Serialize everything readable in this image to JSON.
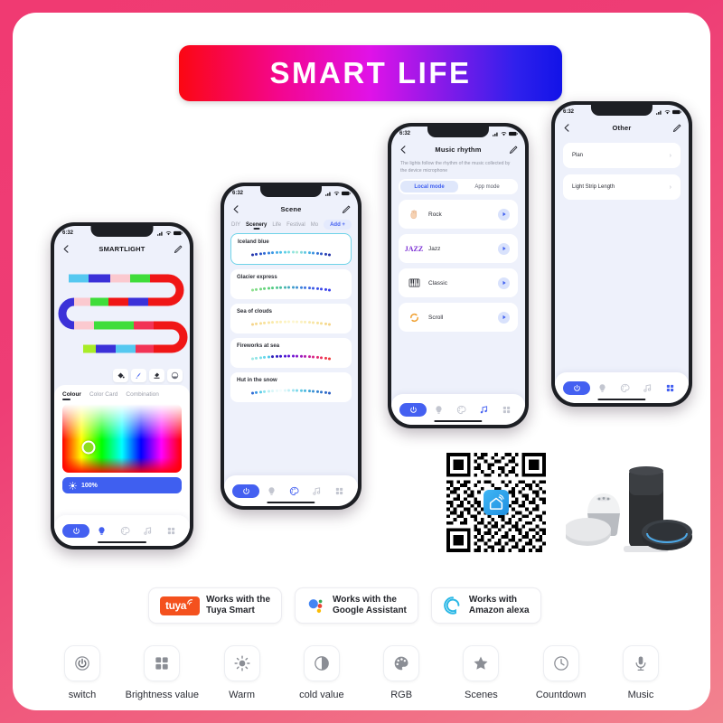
{
  "banner": {
    "title": "SMART LIFE"
  },
  "colors": {
    "frame_pink": "#f03a72",
    "accent_blue": "#4460f1",
    "tuya_orange": "#f4511e",
    "alexa_cyan": "#2bb8e6",
    "banner_from": "#fb0712",
    "banner_mid": "#e012e8",
    "banner_to": "#1213e8"
  },
  "phone1": {
    "status": {
      "time": "6:32",
      "location_icon": "location-arrow-icon",
      "signal_icon": "signal-icon",
      "wifi_icon": "wifi-icon",
      "battery_icon": "battery-icon"
    },
    "nav": {
      "back_icon": "chevron-left-icon",
      "title": "SMARTLIGHT",
      "edit_icon": "pencil-edit-icon"
    },
    "tools": [
      "paint-bucket-icon",
      "brush-icon",
      "eraser-icon",
      "segment-picker-icon"
    ],
    "tabs": [
      {
        "label": "Colour",
        "active": true
      },
      {
        "label": "Color Card",
        "active": false
      },
      {
        "label": "Combination",
        "active": false
      }
    ],
    "brightness": {
      "icon": "brightness-icon",
      "value": "100%"
    },
    "strip_rows": [
      [
        "#55c8f0",
        "#3b31d8",
        "#fbc9cf",
        "#3fdd3a",
        "#f01616"
      ],
      [
        "#fbc9cf",
        "#3fdd3a",
        "#f01616",
        "#3b31d8",
        "#f01616"
      ],
      [
        "#fbc9cf",
        "#3fdd3a",
        "#3fdd3a",
        "#f23355",
        "#f01616"
      ],
      [
        "#a8ec27",
        "#3b31d8",
        "#55c8f0",
        "#f23355",
        "#f01616"
      ]
    ],
    "tabbar": [
      "power-icon",
      "bulb-icon",
      "palette-icon",
      "music-note-icon",
      "grid-icon"
    ],
    "tabbar_active": 1
  },
  "phone2": {
    "status": {
      "time": "6:32"
    },
    "nav": {
      "title": "Scene"
    },
    "tabs": [
      {
        "label": "DIY",
        "active": false
      },
      {
        "label": "Scenery",
        "active": true
      },
      {
        "label": "Life",
        "active": false
      },
      {
        "label": "Festival",
        "active": false
      },
      {
        "label": "Mo",
        "active": false
      }
    ],
    "add_label": "Add +",
    "scenes": [
      {
        "name": "Iceland blue",
        "selected": true,
        "colors": [
          "#2433a8",
          "#2740bb",
          "#2a55c8",
          "#2f6ad4",
          "#3280dd",
          "#3a96e4",
          "#42abe8",
          "#4dc0ea",
          "#5ccfe6",
          "#74dbe2",
          "#8fe4e0",
          "#a8ead2",
          "#7fd8dd",
          "#5fc6e2",
          "#46b0e4",
          "#3a93e0",
          "#3574d6",
          "#2f57c6",
          "#2b42b5",
          "#2433a8"
        ]
      },
      {
        "name": "Glacier express",
        "selected": false,
        "colors": [
          "#8de08f",
          "#7fdc86",
          "#72d880",
          "#66d47c",
          "#5bd079",
          "#54cc82",
          "#4ec590",
          "#49bd9f",
          "#45b4ae",
          "#42a9bd",
          "#409dca",
          "#3f90d4",
          "#3e82dc",
          "#3d73e1",
          "#3c66e4",
          "#3b59e6",
          "#3a4ee8",
          "#3a46e9",
          "#3941ea",
          "#393eea"
        ]
      },
      {
        "name": "Sea of clouds",
        "selected": false,
        "colors": [
          "#f5d48a",
          "#f6d98f",
          "#f7dd95",
          "#f8e19b",
          "#f9e5a2",
          "#f9e9a9",
          "#fbedb1",
          "#fcf0b9",
          "#fcf3c1",
          "#fdf5c9",
          "#fdf6d0",
          "#fcf4c9",
          "#fbf1c0",
          "#faeeb7",
          "#f9eaae",
          "#f8e6a5",
          "#f7e29c",
          "#f6dd93",
          "#f5d88c",
          "#f5d486"
        ]
      },
      {
        "name": "Fireworks at sea",
        "selected": false,
        "colors": [
          "#9fe8e4",
          "#8ce3e6",
          "#79dee8",
          "#63d6ea",
          "#4cc8ea",
          "#2f1fb8",
          "#2b18c2",
          "#3a14cc",
          "#4b12d3",
          "#5c12d6",
          "#7013d4",
          "#8415ca",
          "#9a18bd",
          "#b11bad",
          "#c61f9a",
          "#d82486",
          "#e42a72",
          "#ec305e",
          "#ef364a",
          "#ef3b3b"
        ]
      },
      {
        "name": "Hut in the snow",
        "selected": false,
        "colors": [
          "#2f6ad4",
          "#3a96e4",
          "#59cbe8",
          "#8fe4ee",
          "#b9eef3",
          "#d8f6f8",
          "#e8fafb",
          "#f2fdfd",
          "#ddf6f9",
          "#bfeef5",
          "#9ce4f0",
          "#7ad7ea",
          "#5ec8e4",
          "#4ab6de",
          "#3fa4d8",
          "#3a92d4",
          "#3583d0",
          "#3176cc",
          "#2f6ac8",
          "#2d60c4"
        ]
      }
    ],
    "tabbar_active": 2
  },
  "phone3": {
    "status": {
      "time": "6:32"
    },
    "nav": {
      "title": "Music rhythm"
    },
    "description": "The lights follow the rhythm of the music collected by the device microphone",
    "modes": [
      {
        "label": "Local mode",
        "active": true
      },
      {
        "label": "App mode",
        "active": false
      }
    ],
    "tracks": [
      {
        "name": "Rock",
        "icon": "rock-hand-icon",
        "play_icon": "play-icon"
      },
      {
        "name": "Jazz",
        "icon": "jazz-text-icon",
        "play_icon": "play-icon"
      },
      {
        "name": "Classic",
        "icon": "piano-icon",
        "play_icon": "play-icon"
      },
      {
        "name": "Scroll",
        "icon": "scroll-refresh-icon",
        "play_icon": "play-icon"
      }
    ],
    "tabbar_active": 3
  },
  "phone4": {
    "status": {
      "time": "6:32"
    },
    "nav": {
      "title": "Other"
    },
    "rows": [
      {
        "label": "Plan",
        "chevron": "›"
      },
      {
        "label": "Light Strip Length",
        "chevron": "›"
      }
    ],
    "tabbar_active": 4
  },
  "qr": {
    "name": "qr-code",
    "center_icon": "smart-life-house-icon"
  },
  "speakers": {
    "name": "smart-speakers-image"
  },
  "badges": [
    {
      "id": "tuya",
      "logo_text": "tuya",
      "line1": "Works  with the",
      "line2": "Tuya Smart"
    },
    {
      "id": "google",
      "logo_text": "",
      "line1": "Works  with the",
      "line2": "Google Assistant"
    },
    {
      "id": "alexa",
      "logo_text": "",
      "line1": "Works with",
      "line2": "Amazon alexa"
    }
  ],
  "features": [
    {
      "label": "switch",
      "icon": "power-icon"
    },
    {
      "label": "Brightness value",
      "icon": "grid-icon"
    },
    {
      "label": "Warm",
      "icon": "sun-icon"
    },
    {
      "label": "cold value",
      "icon": "half-circle-icon"
    },
    {
      "label": "RGB",
      "icon": "palette-icon"
    },
    {
      "label": "Scenes",
      "icon": "star-icon"
    },
    {
      "label": "Countdown",
      "icon": "clock-icon"
    },
    {
      "label": "Music",
      "icon": "microphone-icon"
    }
  ]
}
